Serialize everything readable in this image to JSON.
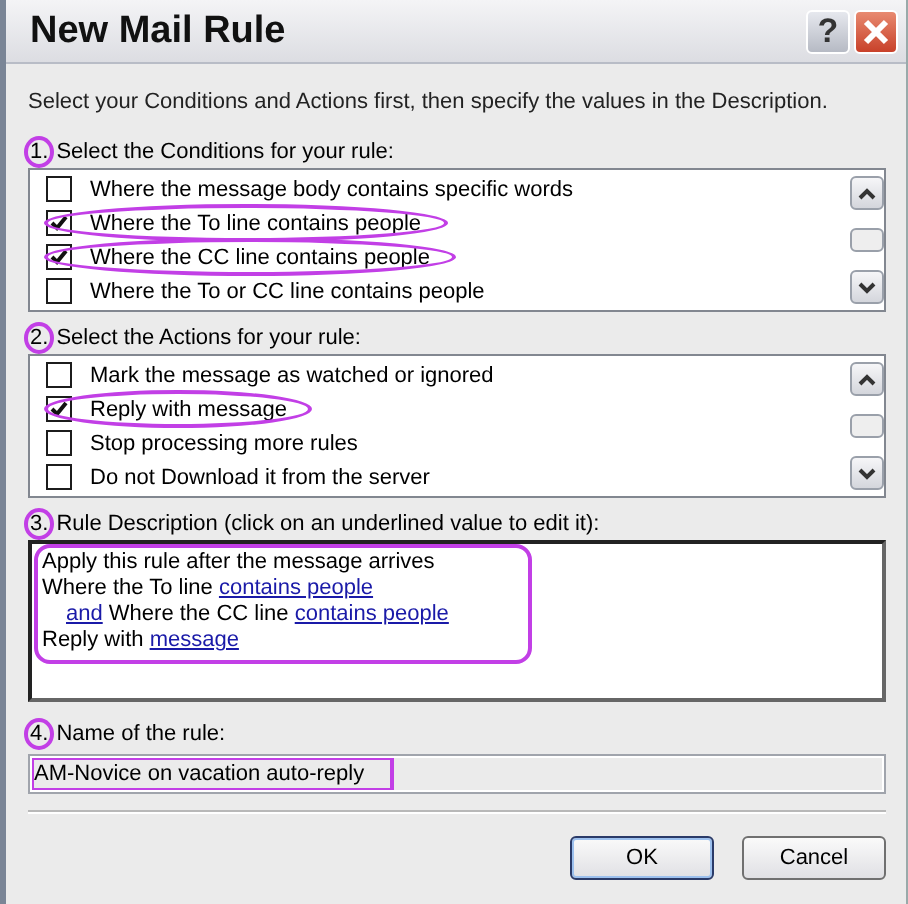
{
  "window": {
    "title": "New Mail Rule",
    "help": "?"
  },
  "instruction": "Select your Conditions and Actions first, then specify the values in the Description.",
  "conditions": {
    "number": "1.",
    "number_circled": true,
    "label": "Select the Conditions for your rule:",
    "items": [
      {
        "label": "Where the message body contains specific words",
        "checked": false,
        "circled": false
      },
      {
        "label": "Where the To line contains people",
        "checked": true,
        "circled": true
      },
      {
        "label": "Where the CC line contains people",
        "checked": true,
        "circled": true
      },
      {
        "label": "Where the To or CC line contains people",
        "checked": false,
        "circled": false
      }
    ]
  },
  "actions": {
    "number": "2.",
    "number_circled": true,
    "label": "Select the Actions for your rule:",
    "items": [
      {
        "label": "Mark the message as watched or ignored",
        "checked": false,
        "circled": false
      },
      {
        "label": "Reply with message",
        "checked": true,
        "circled": true
      },
      {
        "label": "Stop processing more rules",
        "checked": false,
        "circled": false
      },
      {
        "label": "Do not Download it from the server",
        "checked": false,
        "circled": false
      }
    ]
  },
  "description": {
    "number": "3.",
    "number_circled": true,
    "label": "Rule Description (click on an underlined value to edit it):",
    "circled": true,
    "lines": [
      {
        "indented": false,
        "segments": [
          {
            "kind": "text",
            "text": "Apply this rule after the message arrives"
          }
        ]
      },
      {
        "indented": false,
        "segments": [
          {
            "kind": "text",
            "text": "Where the To line"
          },
          {
            "kind": "link",
            "text": "contains people"
          }
        ]
      },
      {
        "indented": true,
        "segments": [
          {
            "kind": "link",
            "text": "and"
          },
          {
            "kind": "text",
            "text": "Where the CC line"
          },
          {
            "kind": "link",
            "text": "contains people"
          }
        ]
      },
      {
        "indented": false,
        "segments": [
          {
            "kind": "text",
            "text": "Reply with"
          },
          {
            "kind": "link",
            "text": "message"
          }
        ]
      }
    ]
  },
  "rule_name": {
    "number": "4.",
    "number_circled": true,
    "label": "Name of the rule:",
    "value": "AM-Novice on vacation auto-reply",
    "circled": true
  },
  "buttons": [
    {
      "label": "OK",
      "default": true
    },
    {
      "label": "Cancel",
      "default": false
    }
  ]
}
